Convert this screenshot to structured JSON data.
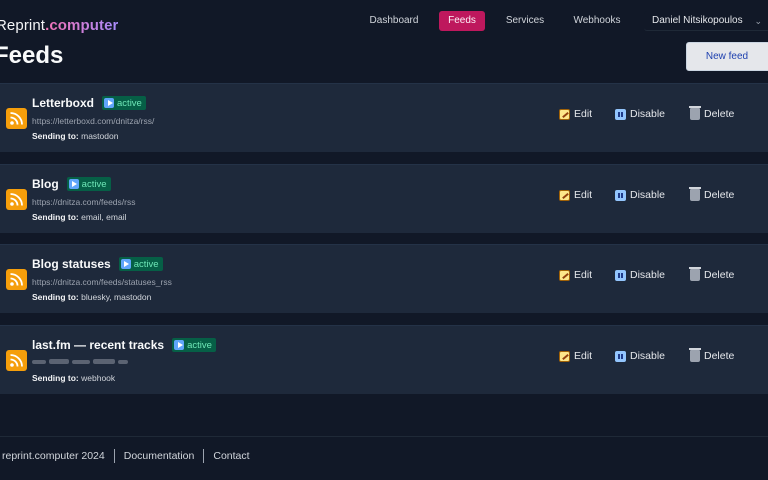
{
  "brand": {
    "prefix": "Reprint",
    "accent": ".computer"
  },
  "nav": {
    "items": [
      {
        "label": "Dashboard",
        "active": false
      },
      {
        "label": "Feeds",
        "active": true
      },
      {
        "label": "Services",
        "active": false
      },
      {
        "label": "Webhooks",
        "active": false
      }
    ],
    "user": "Daniel Nitsikopoulos"
  },
  "page": {
    "title": "Feeds",
    "new_feed_label": "New feed"
  },
  "feeds": [
    {
      "title": "Letterboxd",
      "status": "active",
      "url": "https://letterboxd.com/dnitza/rss/",
      "sending_label": "Sending to:",
      "targets": "mastodon",
      "url_blurred": false
    },
    {
      "title": "Blog",
      "status": "active",
      "url": "https://dnitza.com/feeds/rss",
      "sending_label": "Sending to:",
      "targets": "email, email",
      "url_blurred": false
    },
    {
      "title": "Blog statuses",
      "status": "active",
      "url": "https://dnitza.com/feeds/statuses_rss",
      "sending_label": "Sending to:",
      "targets": "bluesky, mastodon",
      "url_blurred": false
    },
    {
      "title": "last.fm — recent tracks",
      "status": "active",
      "url": "",
      "sending_label": "Sending to:",
      "targets": "webhook",
      "url_blurred": true
    }
  ],
  "actions": {
    "edit": "Edit",
    "disable": "Disable",
    "delete": "Delete"
  },
  "footer": {
    "copyright": "reprint.computer 2024",
    "docs": "Documentation",
    "contact": "Contact"
  },
  "colors": {
    "background": "#111827",
    "row": "#1e293b",
    "accent": "#be185d",
    "badge": "#065f46",
    "rss": "#f59e0b"
  },
  "icons": [
    "rss-icon",
    "play-icon",
    "pencil-icon",
    "pause-icon",
    "trash-icon",
    "chevron-down-icon"
  ]
}
